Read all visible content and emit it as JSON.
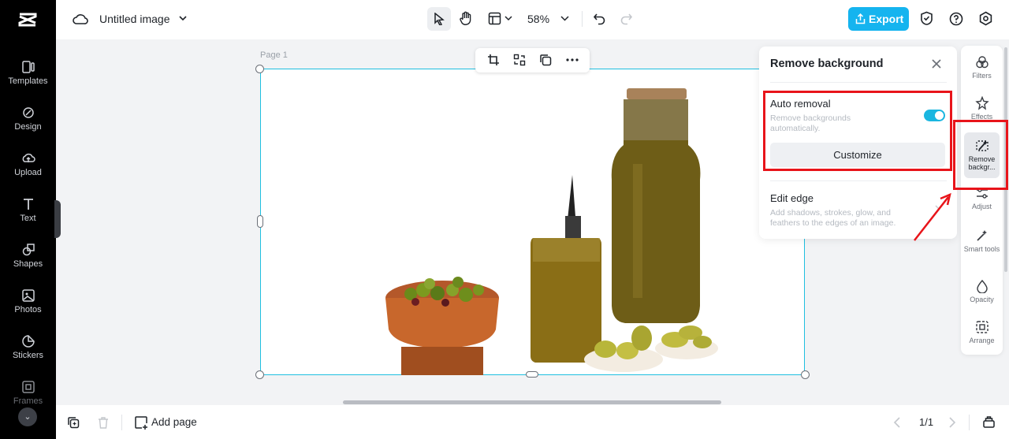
{
  "app": {
    "title": "Untitled image"
  },
  "sidebar": {
    "items": [
      {
        "label": "Templates",
        "icon": "templates-icon"
      },
      {
        "label": "Design",
        "icon": "design-icon"
      },
      {
        "label": "Upload",
        "icon": "upload-icon"
      },
      {
        "label": "Text",
        "icon": "text-icon"
      },
      {
        "label": "Shapes",
        "icon": "shapes-icon"
      },
      {
        "label": "Photos",
        "icon": "photos-icon"
      },
      {
        "label": "Stickers",
        "icon": "stickers-icon"
      },
      {
        "label": "Frames",
        "icon": "frames-icon"
      }
    ]
  },
  "toolbar": {
    "zoom": "58%",
    "export_label": "Export"
  },
  "canvas": {
    "page_label": "Page 1"
  },
  "panel": {
    "title": "Remove background",
    "auto_removal": {
      "title": "Auto removal",
      "description": "Remove backgrounds automatically.",
      "enabled": true,
      "customize_label": "Customize"
    },
    "edit_edge": {
      "title": "Edit edge",
      "description": "Add shadows, strokes, glow, and feathers to the edges of an image."
    }
  },
  "right_tools": [
    {
      "label": "Filters",
      "icon": "filters-icon"
    },
    {
      "label": "Effects",
      "icon": "effects-icon"
    },
    {
      "label": "Remove backgr...",
      "icon": "remove-background-icon",
      "active": true
    },
    {
      "label": "Adjust",
      "icon": "adjust-icon"
    },
    {
      "label": "Smart tools",
      "icon": "smart-tools-icon"
    },
    {
      "label": "Opacity",
      "icon": "opacity-icon"
    },
    {
      "label": "Arrange",
      "icon": "arrange-icon"
    }
  ],
  "bottom": {
    "add_page_label": "Add page",
    "page_indicator": "1/1"
  },
  "colors": {
    "accent": "#15b4ef",
    "annotation": "#e8141a",
    "selection": "#1fbfe0"
  }
}
